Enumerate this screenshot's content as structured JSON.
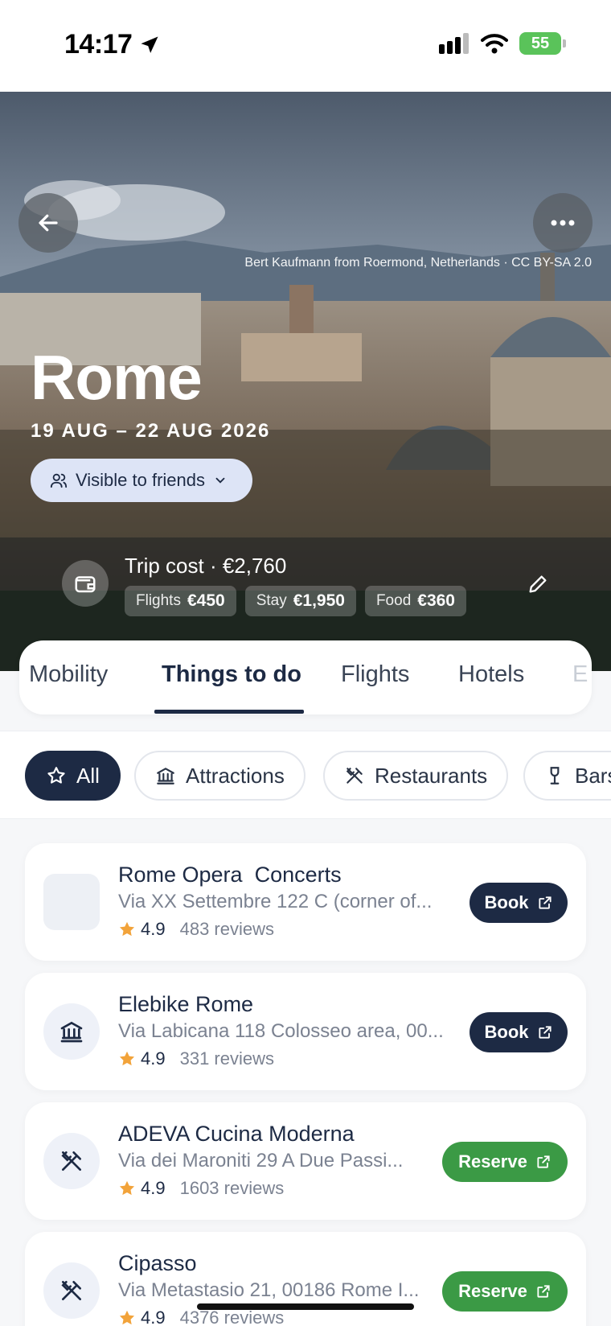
{
  "status_bar": {
    "time": "14:17",
    "battery": "55"
  },
  "hero": {
    "photo_credit": "Bert Kaufmann from Roermond, Netherlands · CC BY-SA 2.0",
    "city": "Rome",
    "dates": "19 AUG – 22 AUG 2026",
    "visibility_label": "Visible to friends",
    "trip_cost": "Trip cost · €2,760",
    "cost_chips": [
      {
        "label": "Flights",
        "value": "€450"
      },
      {
        "label": "Stay",
        "value": "€1,950"
      },
      {
        "label": "Food",
        "value": "€360"
      }
    ]
  },
  "tabs": [
    "Mobility",
    "Things to do",
    "Flights",
    "Hotels",
    "E"
  ],
  "active_tab": "Things to do",
  "filters": [
    "All",
    "Attractions",
    "Restaurants",
    "Bars"
  ],
  "active_filter": "All",
  "places": [
    {
      "name": "Rome Opera  Concerts",
      "address": "Via XX Settembre 122 C (corner of...",
      "rating": "4.9",
      "reviews": "483 reviews",
      "action": "Book",
      "icon": "placeholder-image"
    },
    {
      "name": "Elebike Rome",
      "address": "Via Labicana 118 Colosseo area, 00...",
      "rating": "4.9",
      "reviews": "331 reviews",
      "action": "Book",
      "icon": "landmark-icon"
    },
    {
      "name": "ADEVA Cucina Moderna",
      "address": "Via dei Maroniti 29 A Due Passi...",
      "rating": "4.9",
      "reviews": "1603 reviews",
      "action": "Reserve",
      "icon": "utensils-crossed-icon"
    },
    {
      "name": "Cipasso",
      "address": "Via Metastasio 21, 00186 Rome I...",
      "rating": "4.9",
      "reviews": "4376 reviews",
      "action": "Reserve",
      "icon": "utensils-crossed-icon"
    }
  ],
  "colors": {
    "navy": "#1d2a44",
    "green": "#3b9a45",
    "star": "#f2a33a",
    "pill": "#dde4f6"
  }
}
